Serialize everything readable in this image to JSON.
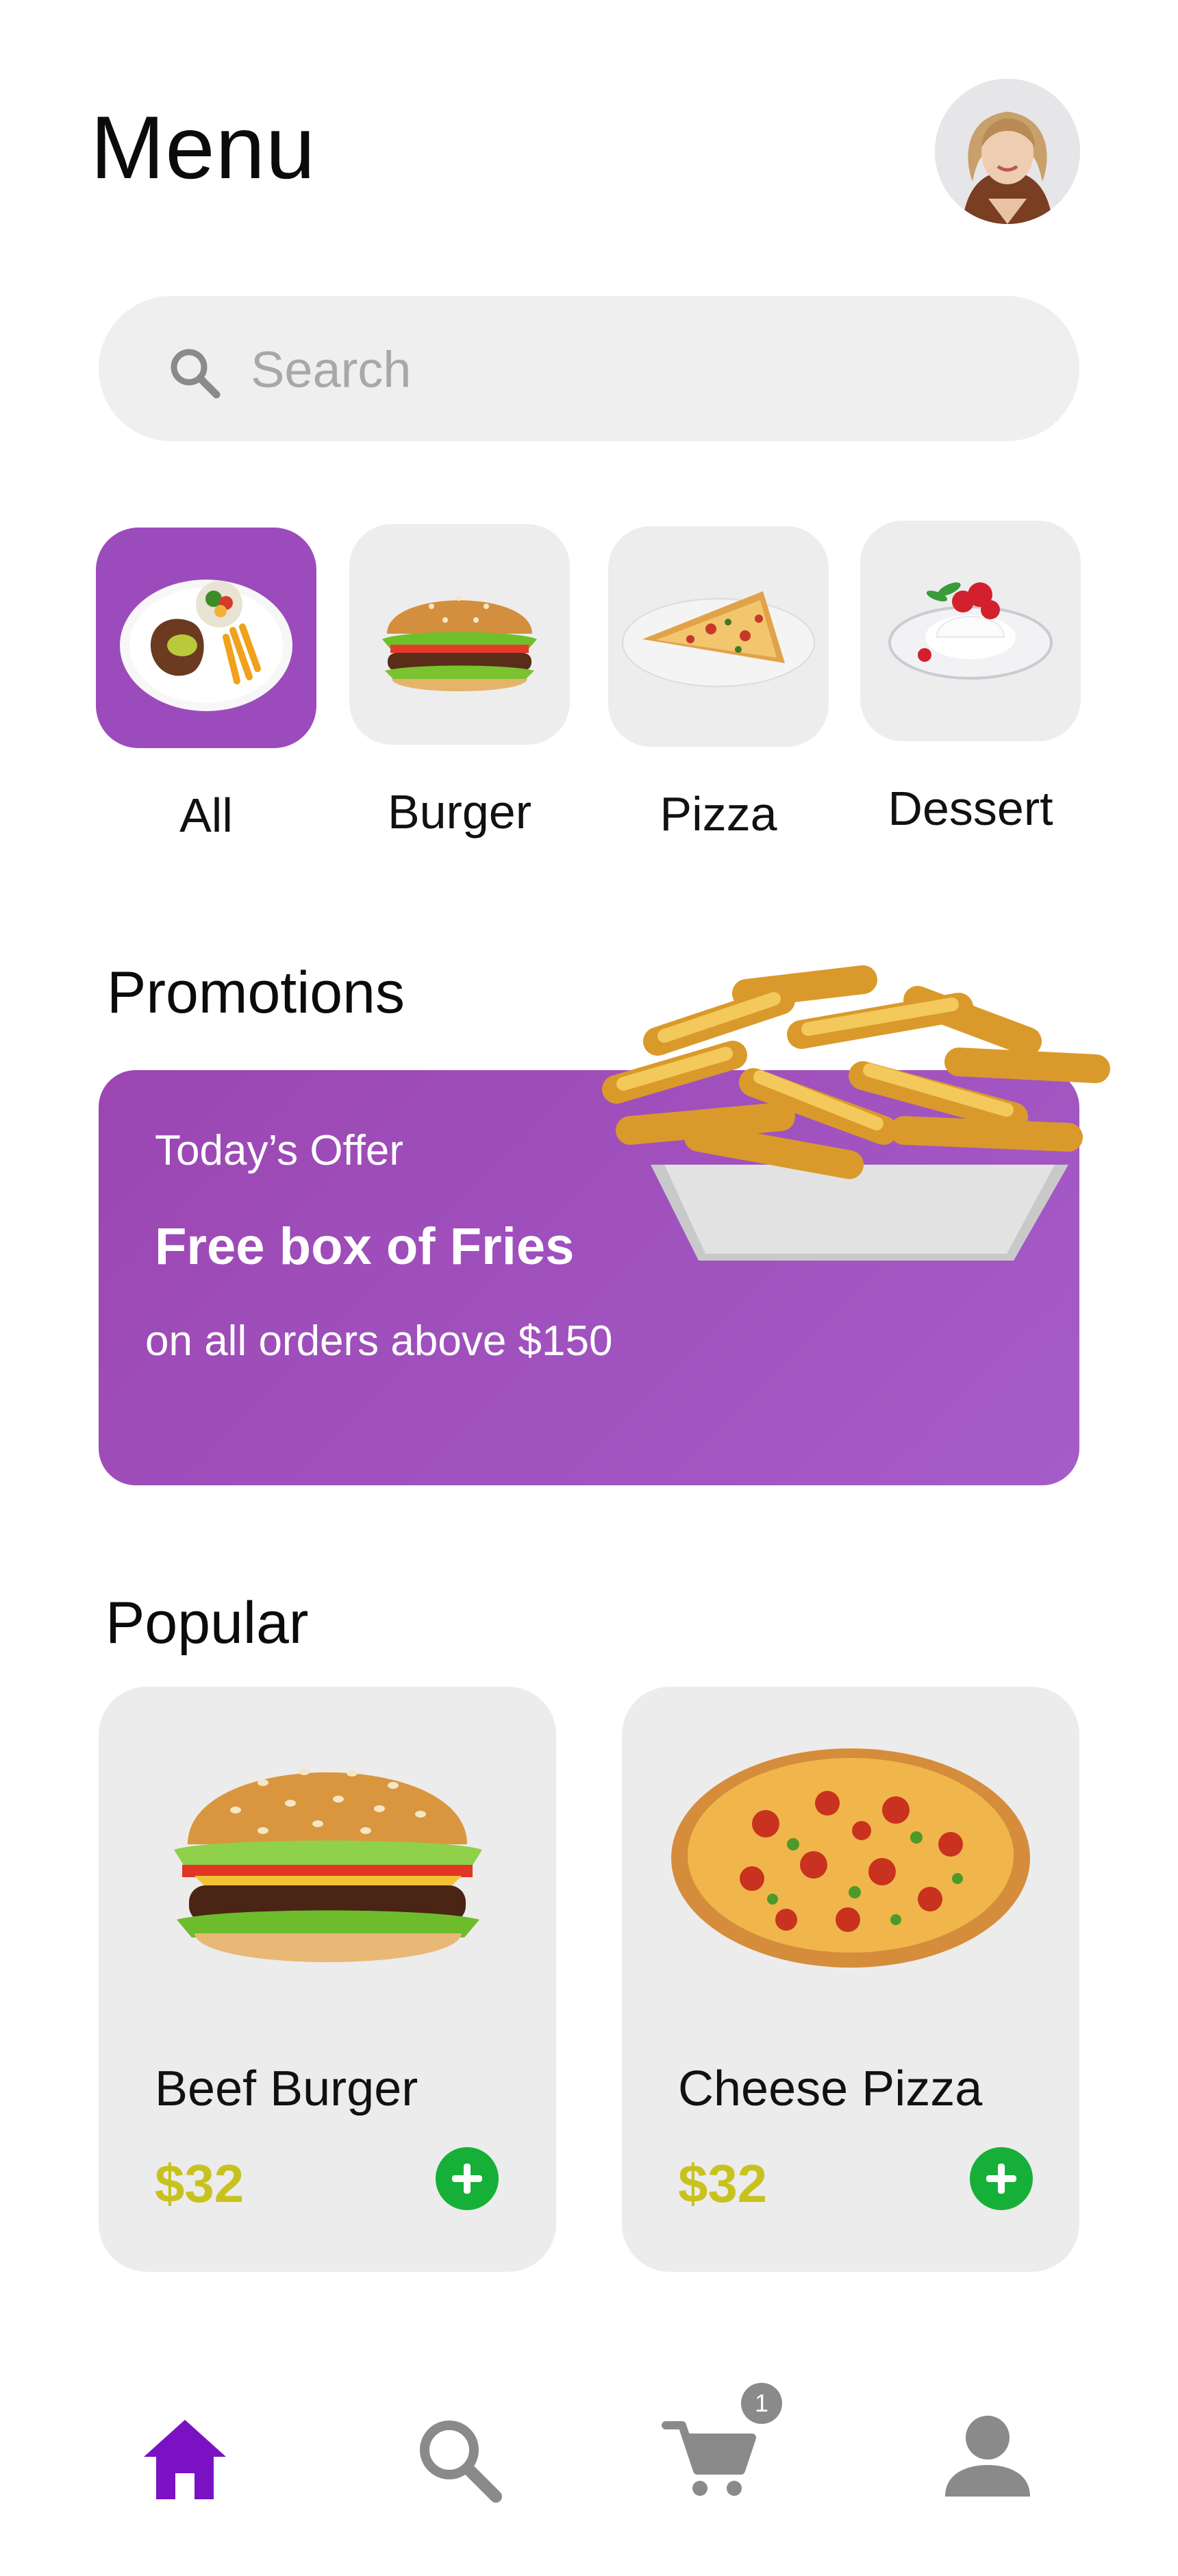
{
  "header": {
    "title": "Menu"
  },
  "search": {
    "placeholder": "Search"
  },
  "categories": [
    {
      "label": "All",
      "active": true
    },
    {
      "label": "Burger",
      "active": false
    },
    {
      "label": "Pizza",
      "active": false
    },
    {
      "label": "Dessert",
      "active": false
    }
  ],
  "promotions": {
    "heading": "Promotions",
    "subtitle": "Today’s Offer",
    "title": "Free box of Fries",
    "description": "on all orders above $150"
  },
  "popular": {
    "heading": "Popular",
    "items": [
      {
        "name": "Beef Burger",
        "price": "$32"
      },
      {
        "name": "Cheese Pizza",
        "price": "$32"
      }
    ]
  },
  "nav": {
    "items": [
      "home-icon",
      "search-icon",
      "cart-icon",
      "profile-icon"
    ],
    "cart_count": "1",
    "active_color": "#7a12c4",
    "inactive_color": "#8a8a8a"
  },
  "colors": {
    "accent": "#9c4bbd",
    "price": "#c8c21f",
    "add_button": "#16b038"
  }
}
